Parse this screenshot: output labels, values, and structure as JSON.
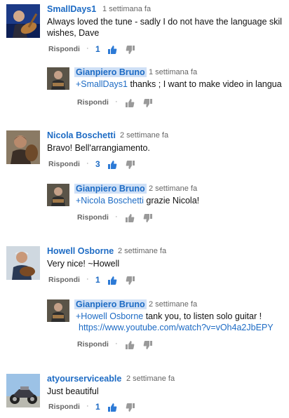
{
  "reply_label": "Rispondi",
  "dot": "·",
  "comments": [
    {
      "author": "SmallDays1",
      "time": "1 settimana fa",
      "text": "Always loved the tune - sadly I do not have the language skil",
      "text2": "wishes, Dave",
      "likes": "1"
    },
    {
      "author": "Nicola Boschetti",
      "time": "2 settimane fa",
      "text": "Bravo! Bell'arrangiamento.",
      "likes": "3"
    },
    {
      "author": "Howell Osborne",
      "time": "2 settimane fa",
      "text": "Very nice! ~Howell",
      "likes": "1"
    },
    {
      "author": "atyourserviceable",
      "time": "2 settimane fa",
      "text": "Just beautiful",
      "likes": "1"
    }
  ],
  "replies": [
    {
      "author": "Gianpiero Bruno",
      "time": "1 settimana fa",
      "mention": "+SmallDays1",
      "text": " thanks ; I want to make video  in langua"
    },
    {
      "author": "Gianpiero Bruno",
      "time": "2 settimane fa",
      "mention": "+Nicola Boschetti",
      "text": " grazie Nicola!"
    },
    {
      "author": "Gianpiero Bruno",
      "time": "2 settimane fa",
      "mention": "+Howell Osborne",
      "text": " tank you, to listen solo guitar !",
      "link": "https://www.youtube.com/watch?v=vOh4a2JbEPY"
    }
  ],
  "colors": {
    "link": "#1d6bc4",
    "highlight": "#cfe0f6",
    "thumb_active": "#2c7ad6",
    "thumb_inactive": "#9a9a9a"
  }
}
